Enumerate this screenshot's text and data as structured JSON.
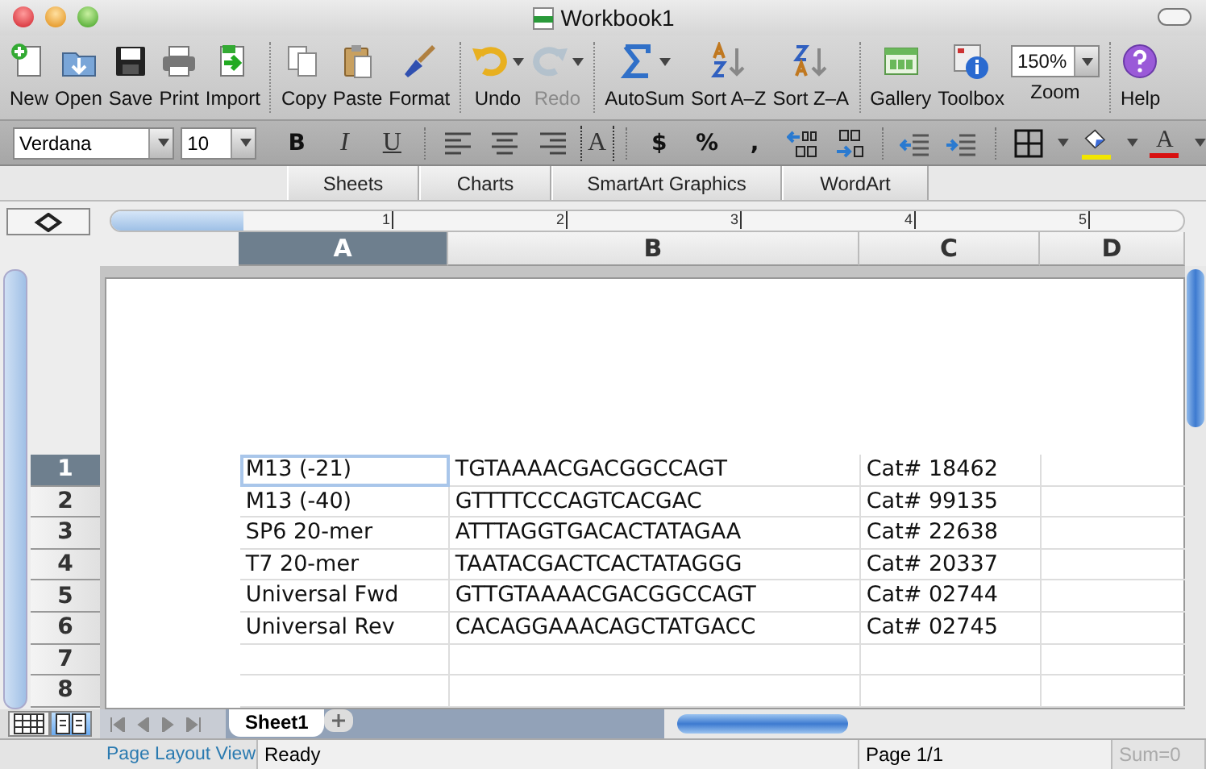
{
  "window": {
    "title": "Workbook1"
  },
  "toolbar": [
    {
      "kind": "button",
      "label": "New",
      "disabled": false,
      "menu": false
    },
    {
      "kind": "button",
      "label": "Open",
      "disabled": false,
      "menu": false
    },
    {
      "kind": "button",
      "label": "Save",
      "disabled": false,
      "menu": false
    },
    {
      "kind": "button",
      "label": "Print",
      "disabled": false,
      "menu": false
    },
    {
      "kind": "button",
      "label": "Import",
      "disabled": false,
      "menu": false
    },
    {
      "kind": "separator"
    },
    {
      "kind": "button",
      "label": "Copy",
      "disabled": false,
      "menu": false
    },
    {
      "kind": "button",
      "label": "Paste",
      "disabled": false,
      "menu": false
    },
    {
      "kind": "button",
      "label": "Format",
      "disabled": false,
      "menu": false
    },
    {
      "kind": "separator"
    },
    {
      "kind": "button",
      "label": "Undo",
      "disabled": false,
      "menu": true
    },
    {
      "kind": "button",
      "label": "Redo",
      "disabled": true,
      "menu": true
    },
    {
      "kind": "separator"
    },
    {
      "kind": "button",
      "label": "AutoSum",
      "disabled": false,
      "menu": true
    },
    {
      "kind": "button",
      "label": "Sort A–Z",
      "disabled": false,
      "menu": false
    },
    {
      "kind": "button",
      "label": "Sort Z–A",
      "disabled": false,
      "menu": false
    },
    {
      "kind": "separator"
    },
    {
      "kind": "button",
      "label": "Gallery",
      "disabled": false,
      "menu": false
    },
    {
      "kind": "button",
      "label": "Toolbox",
      "disabled": false,
      "menu": false
    },
    {
      "kind": "combo",
      "value": "150%",
      "label": "Zoom"
    },
    {
      "kind": "separator"
    },
    {
      "kind": "button",
      "label": "Help",
      "disabled": false,
      "menu": false
    }
  ],
  "format_bar": {
    "font": "Verdana",
    "size": "10",
    "text_buttons": [
      "B",
      "I",
      "U",
      "A",
      "$",
      "%",
      ","
    ],
    "fill_button": {
      "color": "#f2e600"
    },
    "font_color": {
      "text": "A",
      "color": "#d81010"
    }
  },
  "ribbon_tabs": [
    "Sheets",
    "Charts",
    "SmartArt Graphics",
    "WordArt"
  ],
  "ruler": [
    "1",
    "2",
    "3",
    "4",
    "5"
  ],
  "columns": [
    {
      "label": "A",
      "selected": true
    },
    {
      "label": "B",
      "selected": false
    },
    {
      "label": "C",
      "selected": false
    },
    {
      "label": "D",
      "selected": false
    }
  ],
  "rows": [
    {
      "number": "1",
      "selected": true,
      "cells": [
        "M13 (-21)",
        "TGTAAAACGACGGCCAGT",
        "Cat# 18462"
      ]
    },
    {
      "number": "2",
      "selected": false,
      "cells": [
        "M13 (-40)",
        "GTTTTCCCAGTCACGAC",
        "Cat# 99135"
      ]
    },
    {
      "number": "3",
      "selected": false,
      "cells": [
        "SP6 20-mer",
        "ATTTAGGTGACACTATAGAA",
        "Cat# 22638"
      ]
    },
    {
      "number": "4",
      "selected": false,
      "cells": [
        "T7 20-mer",
        "TAATACGACTCACTATAGGG",
        "Cat# 20337"
      ]
    },
    {
      "number": "5",
      "selected": false,
      "cells": [
        "Universal Fwd",
        "GTTGTAAAACGACGGCCAGT",
        "Cat# 02744"
      ]
    },
    {
      "number": "6",
      "selected": false,
      "cells": [
        "Universal Rev",
        "CACAGGAAACAGCTATGACC",
        "Cat# 02745"
      ]
    },
    {
      "number": "7",
      "selected": false,
      "cells": []
    },
    {
      "number": "8",
      "selected": false,
      "cells": []
    }
  ],
  "sheet_tabs": [
    {
      "label": "Sheet1",
      "selected": true
    }
  ],
  "view_buttons": [
    {
      "selected": false
    },
    {
      "selected": true
    }
  ],
  "status_bar": {
    "view": "Page Layout View",
    "status": "Ready",
    "page": "Page 1/1",
    "sum": "Sum=0"
  }
}
